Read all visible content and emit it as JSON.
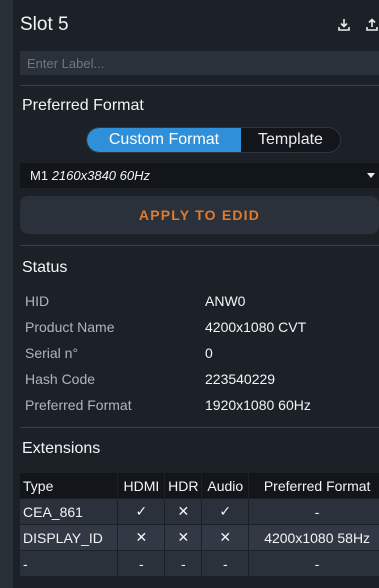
{
  "slot": {
    "title": "Slot 5",
    "label_placeholder": "Enter Label...",
    "icons": [
      "download-icon",
      "upload-icon"
    ]
  },
  "preferred_format": {
    "title": "Preferred Format",
    "tabs": {
      "custom": "Custom Format",
      "template": "Template"
    },
    "active_tab": "custom",
    "select_prefix": "M1",
    "select_resolution": "2160x3840 60Hz",
    "apply_label": "APPLY TO EDID"
  },
  "status": {
    "title": "Status",
    "rows": [
      {
        "key": "HID",
        "value": "ANW0"
      },
      {
        "key": "Product Name",
        "value": "4200x1080 CVT"
      },
      {
        "key": "Serial n°",
        "value": "0"
      },
      {
        "key": "Hash Code",
        "value": "223540229"
      },
      {
        "key": "Preferred Format",
        "value": "1920x1080 60Hz"
      }
    ]
  },
  "extensions": {
    "title": "Extensions",
    "headers": [
      "Type",
      "HDMI",
      "HDR",
      "Audio",
      "Preferred Format"
    ],
    "rows": [
      {
        "type": "CEA_861",
        "hdmi": "✓",
        "hdr": "✕",
        "audio": "✓",
        "preferred": "-"
      },
      {
        "type": "DISPLAY_ID",
        "hdmi": "✕",
        "hdr": "✕",
        "audio": "✕",
        "preferred": "4200x1080 58Hz"
      },
      {
        "type": "-",
        "hdmi": "-",
        "hdr": "-",
        "audio": "-",
        "preferred": "-"
      }
    ]
  },
  "colors": {
    "accent": "#2f8fd8",
    "apply_text": "#e07b2f",
    "check": "#2fbf5a",
    "cross": "#ef3b3b"
  }
}
